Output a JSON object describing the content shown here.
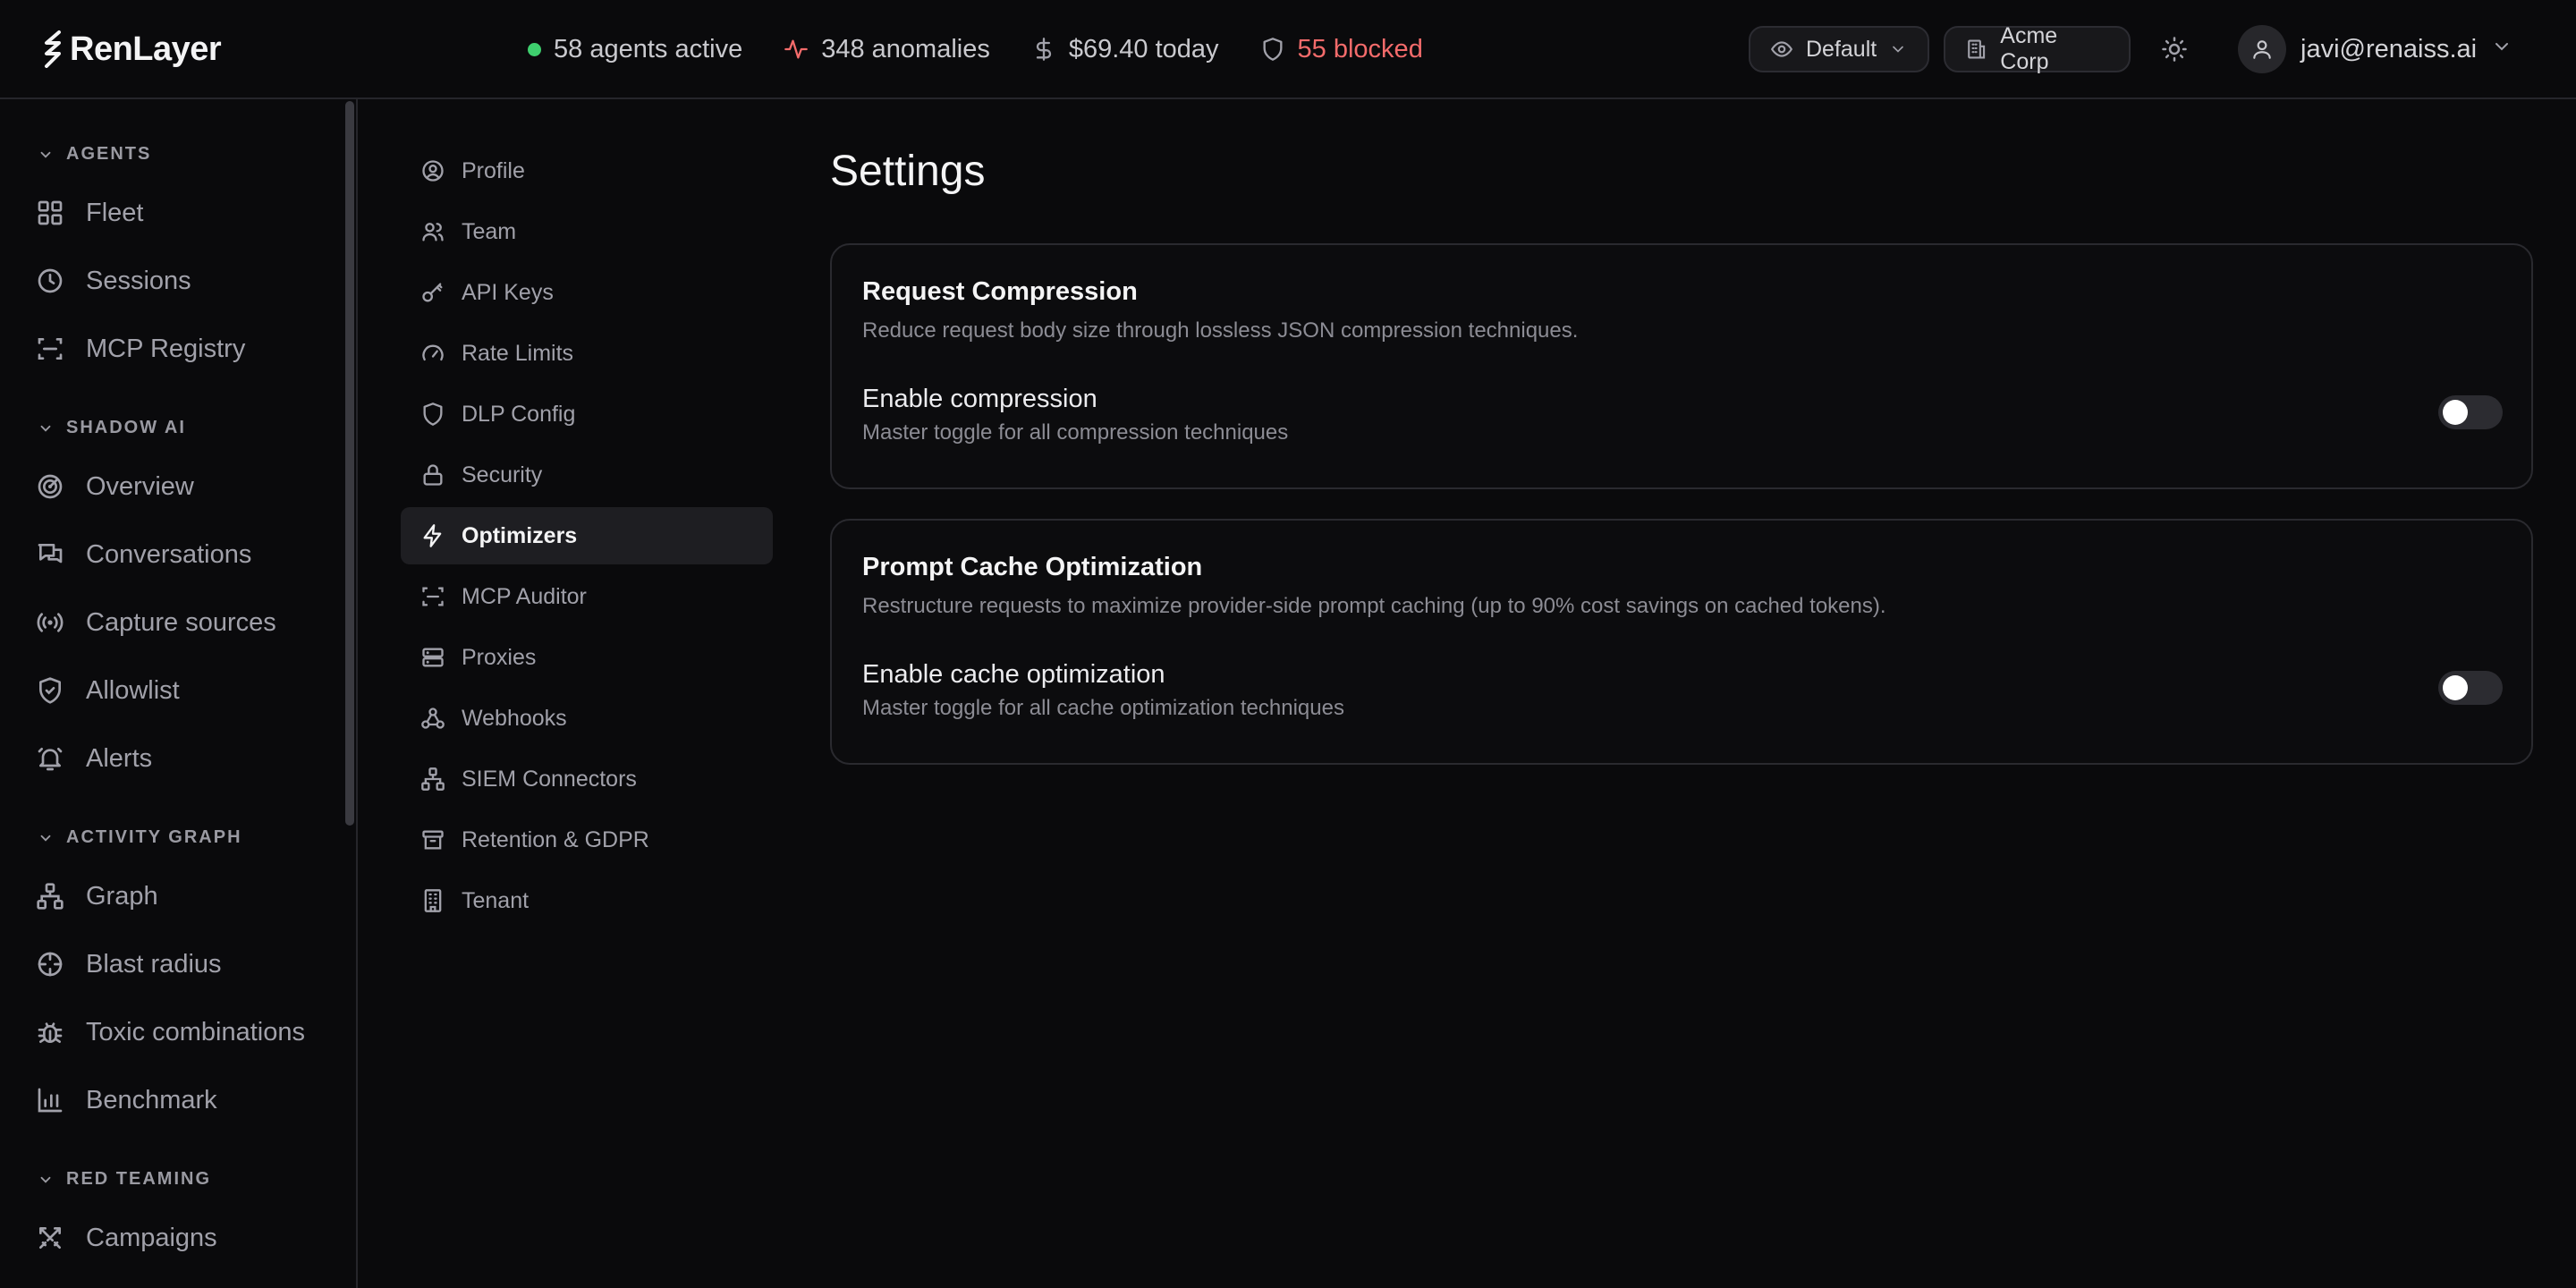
{
  "brand": {
    "name": "RenLayer"
  },
  "header": {
    "agents_active": "58 agents active",
    "anomalies": "348 anomalies",
    "cost_today": "$69.40 today",
    "blocked": "55 blocked",
    "profile_select": "Default",
    "org_select": "Acme Corp",
    "user_email": "javi@renaiss.ai",
    "colors": {
      "status_dot": "#3ecf6e",
      "anomaly_accent": "#f36b6b",
      "blocked_accent": "#f36b6b"
    }
  },
  "sidebar": {
    "groups": [
      {
        "title": "AGENTS",
        "items": [
          {
            "label": "Fleet",
            "icon": "grid-icon"
          },
          {
            "label": "Sessions",
            "icon": "clock-icon"
          },
          {
            "label": "MCP Registry",
            "icon": "scan-icon"
          }
        ]
      },
      {
        "title": "SHADOW AI",
        "items": [
          {
            "label": "Overview",
            "icon": "radar-icon"
          },
          {
            "label": "Conversations",
            "icon": "chat-icon"
          },
          {
            "label": "Capture sources",
            "icon": "broadcast-icon"
          },
          {
            "label": "Allowlist",
            "icon": "shield-check-icon"
          },
          {
            "label": "Alerts",
            "icon": "bell-icon"
          }
        ]
      },
      {
        "title": "ACTIVITY GRAPH",
        "items": [
          {
            "label": "Graph",
            "icon": "graph-icon"
          },
          {
            "label": "Blast radius",
            "icon": "crosshair-icon"
          },
          {
            "label": "Toxic combinations",
            "icon": "bug-icon"
          },
          {
            "label": "Benchmark",
            "icon": "bar-chart-icon"
          }
        ]
      },
      {
        "title": "RED TEAMING",
        "items": [
          {
            "label": "Campaigns",
            "icon": "swords-icon"
          }
        ]
      }
    ]
  },
  "settings_nav": {
    "items": [
      {
        "label": "Profile",
        "icon": "user-circle-icon"
      },
      {
        "label": "Team",
        "icon": "users-icon"
      },
      {
        "label": "API Keys",
        "icon": "key-icon"
      },
      {
        "label": "Rate Limits",
        "icon": "gauge-icon"
      },
      {
        "label": "DLP Config",
        "icon": "shield-icon"
      },
      {
        "label": "Security",
        "icon": "lock-icon"
      },
      {
        "label": "Optimizers",
        "icon": "zap-icon",
        "active": true
      },
      {
        "label": "MCP Auditor",
        "icon": "scan-icon"
      },
      {
        "label": "Proxies",
        "icon": "server-icon"
      },
      {
        "label": "Webhooks",
        "icon": "webhook-icon"
      },
      {
        "label": "SIEM Connectors",
        "icon": "network-icon"
      },
      {
        "label": "Retention & GDPR",
        "icon": "archive-icon"
      },
      {
        "label": "Tenant",
        "icon": "building-icon"
      }
    ]
  },
  "main": {
    "title": "Settings",
    "cards": [
      {
        "title": "Request Compression",
        "description": "Reduce request body size through lossless JSON compression techniques.",
        "setting_label": "Enable compression",
        "setting_sub": "Master toggle for all compression techniques",
        "enabled": false
      },
      {
        "title": "Prompt Cache Optimization",
        "description": "Restructure requests to maximize provider-side prompt caching (up to 90% cost savings on cached tokens).",
        "setting_label": "Enable cache optimization",
        "setting_sub": "Master toggle for all cache optimization techniques",
        "enabled": false
      }
    ]
  }
}
